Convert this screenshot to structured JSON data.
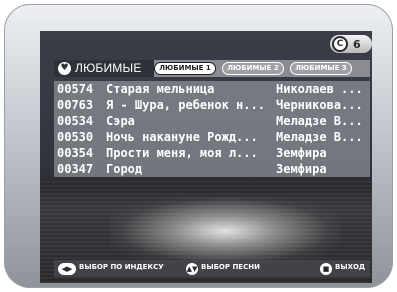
{
  "channel": {
    "badge": "C",
    "number": "6"
  },
  "header": {
    "title": "ЛЮБИМЫЕ",
    "tabs": [
      {
        "label": "ЛЮБИМЫЕ 1",
        "active": true
      },
      {
        "label": "ЛЮБИМЫЕ 2",
        "active": false
      },
      {
        "label": "ЛЮБИМЫЕ 3",
        "active": false
      }
    ]
  },
  "songs": [
    {
      "index": "00574",
      "title": "Старая мельница",
      "artist": "Николаев ..."
    },
    {
      "index": "00763",
      "title": "Я - Шура, ребенок н...",
      "artist": "Черникова..."
    },
    {
      "index": "00534",
      "title": "Сэра",
      "artist": "Меладзе В..."
    },
    {
      "index": "00530",
      "title": "Ночь накануне Рожд...",
      "artist": "Меладзе В..."
    },
    {
      "index": "00354",
      "title": "Прости меня, моя л...",
      "artist": "Земфира"
    },
    {
      "index": "00347",
      "title": "Город",
      "artist": "Земфира"
    }
  ],
  "footer": {
    "index_label": "ВЫБОР ПО ИНДЕКСУ",
    "song_label": "ВЫБОР ПЕСНИ",
    "exit_label": "ВЫХОД"
  },
  "icons": {
    "lr": "◀▶",
    "ud": "▲▼",
    "stop": "■",
    "heart": "♥"
  }
}
